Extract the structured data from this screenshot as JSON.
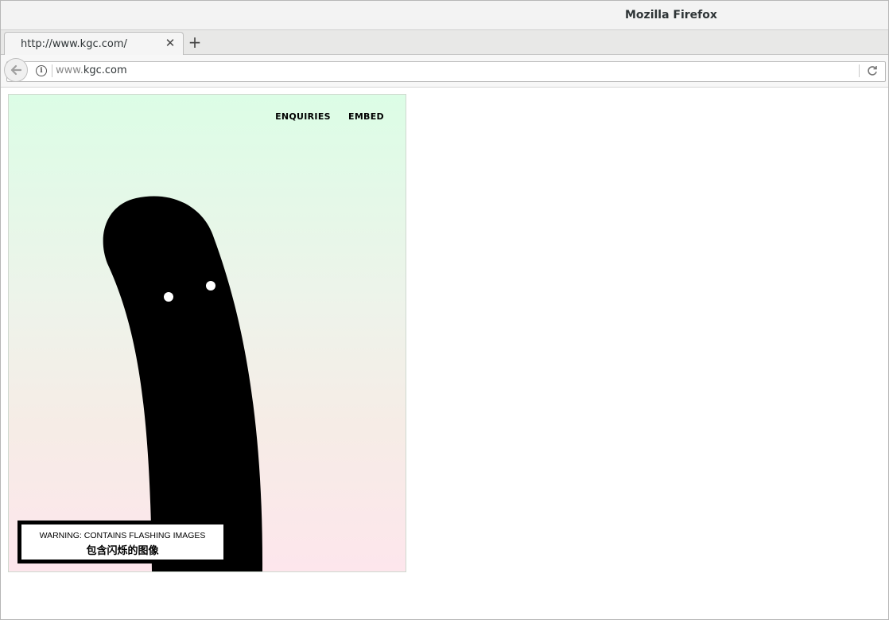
{
  "window": {
    "title": "Mozilla Firefox"
  },
  "tabs": [
    {
      "title": "http://www.kgc.com/",
      "close_icon": "close-icon"
    }
  ],
  "new_tab_icon": "plus-icon",
  "urlbar": {
    "prefix": "www.",
    "domain": "kgc.com",
    "back_icon": "back-arrow-icon",
    "info_icon": "info-icon",
    "reload_icon": "reload-icon"
  },
  "site": {
    "nav": [
      "ENQUIRIES",
      "EMBED"
    ],
    "warning_en": "WARNING: CONTAINS FLASHING IMAGES",
    "warning_zh": "包含闪烁的图像",
    "colors": {
      "gradient_top": "#dcfde6",
      "gradient_bottom": "#fde6ec",
      "creature": "#000000"
    }
  }
}
